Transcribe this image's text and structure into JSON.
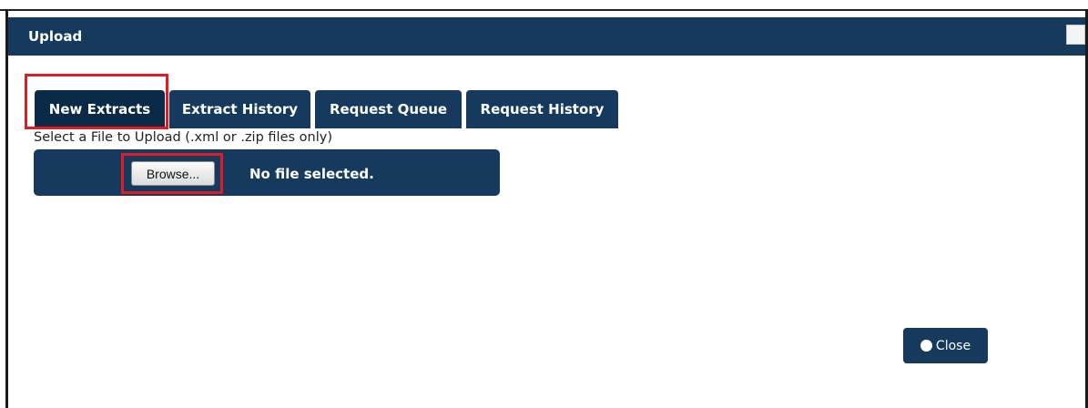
{
  "dialog": {
    "title": "Upload"
  },
  "tabs": [
    {
      "label": "New Extracts",
      "active": true
    },
    {
      "label": "Extract History",
      "active": false
    },
    {
      "label": "Request Queue",
      "active": false
    },
    {
      "label": "Request History",
      "active": false
    }
  ],
  "upload": {
    "label": "Select a File to Upload (.xml or .zip files only)",
    "browse_label": "Browse...",
    "file_status": "No file selected."
  },
  "footer": {
    "close_label": "Close"
  },
  "colors": {
    "primary": "#153a5e",
    "active_tab": "#0b2a47",
    "highlight": "#e01b24"
  }
}
